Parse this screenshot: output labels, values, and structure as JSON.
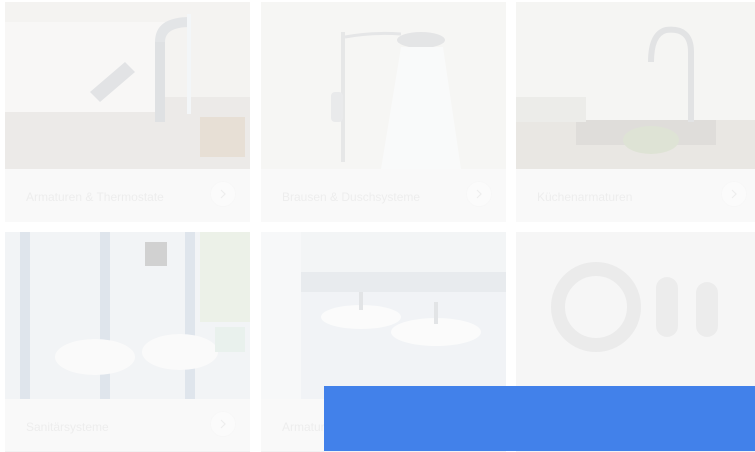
{
  "categories": [
    {
      "label": "Armaturen & Thermostate",
      "image": "faucet-image"
    },
    {
      "label": "Brausen & Duschsysteme",
      "image": "shower-image"
    },
    {
      "label": "Küchenarmaturen",
      "image": "kitchen-faucet-image"
    },
    {
      "label": "Sanitärsysteme",
      "image": "toilet-image"
    },
    {
      "label": "Armaturen gewerb",
      "image": "washbasins-image"
    },
    {
      "label": "",
      "image": "parts-image"
    }
  ],
  "colors": {
    "overlay_blue": "#4281ea",
    "card_bg": "#f3f3f3",
    "label_text": "#d8d8d8"
  }
}
